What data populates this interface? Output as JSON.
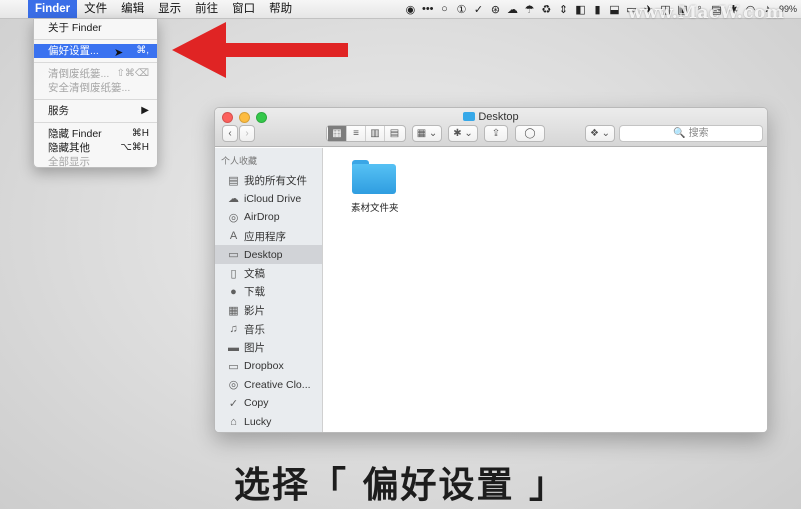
{
  "menubar": {
    "apple_glyph": "",
    "items": [
      "Finder",
      "文件",
      "编辑",
      "显示",
      "前往",
      "窗口",
      "帮助"
    ],
    "status_icons": [
      "◉",
      "•••",
      "○",
      "①",
      "✓",
      "⊛",
      "☁",
      "☂",
      "♻",
      "⇕",
      "◧",
      "▮",
      "⬓",
      "▭",
      "✈",
      "◫",
      "▣",
      "♀",
      "▤",
      "✱",
      "◠",
      "♪"
    ],
    "battery": "99%"
  },
  "watermark": "www.MacW.com",
  "finder_menu": {
    "about": "关于 Finder",
    "preferences": {
      "label": "偏好设置...",
      "shortcut": "⌘,"
    },
    "empty_trash": {
      "label": "清倒废纸篓...",
      "shortcut": "⇧⌘⌫"
    },
    "secure_empty_trash": "安全清倒废纸篓...",
    "services": {
      "label": "服务",
      "arrow": "▶"
    },
    "hide_finder": {
      "label": "隐藏 Finder",
      "shortcut": "⌘H"
    },
    "hide_others": {
      "label": "隐藏其他",
      "shortcut": "⌥⌘H"
    },
    "show_all": "全部显示",
    "cursor": "➤"
  },
  "finder_window": {
    "title": "Desktop",
    "back": "‹",
    "forward": "›",
    "view_icons": [
      "▦",
      "≡",
      "▥",
      "▤"
    ],
    "arrange": "▦ ⌄",
    "action": "✱ ⌄",
    "share": "⇪",
    "tag": "◯",
    "dropbox": "❖ ⌄",
    "search_placeholder": "🔍 搜索",
    "sidebar_header": "个人收藏",
    "sidebar": [
      {
        "icon": "▤",
        "label": "我的所有文件"
      },
      {
        "icon": "☁",
        "label": "iCloud Drive"
      },
      {
        "icon": "◎",
        "label": "AirDrop"
      },
      {
        "icon": "A",
        "label": "应用程序"
      },
      {
        "icon": "▭",
        "label": "Desktop"
      },
      {
        "icon": "▯",
        "label": "文稿"
      },
      {
        "icon": "●",
        "label": "下载"
      },
      {
        "icon": "▦",
        "label": "影片"
      },
      {
        "icon": "♫",
        "label": "音乐"
      },
      {
        "icon": "▬",
        "label": "图片"
      },
      {
        "icon": "▭",
        "label": "Dropbox"
      },
      {
        "icon": "◎",
        "label": "Creative Clo..."
      },
      {
        "icon": "✓",
        "label": "Copy"
      },
      {
        "icon": "⌂",
        "label": "Lucky"
      }
    ],
    "selected_sidebar": "Desktop",
    "folder_label": "素材文件夹"
  },
  "subtitle": "选择「 偏好设置 」",
  "colors": {
    "menu_highlight": "#3a72f0",
    "arrow": "#e02424",
    "folder": "#3aa6e6"
  }
}
